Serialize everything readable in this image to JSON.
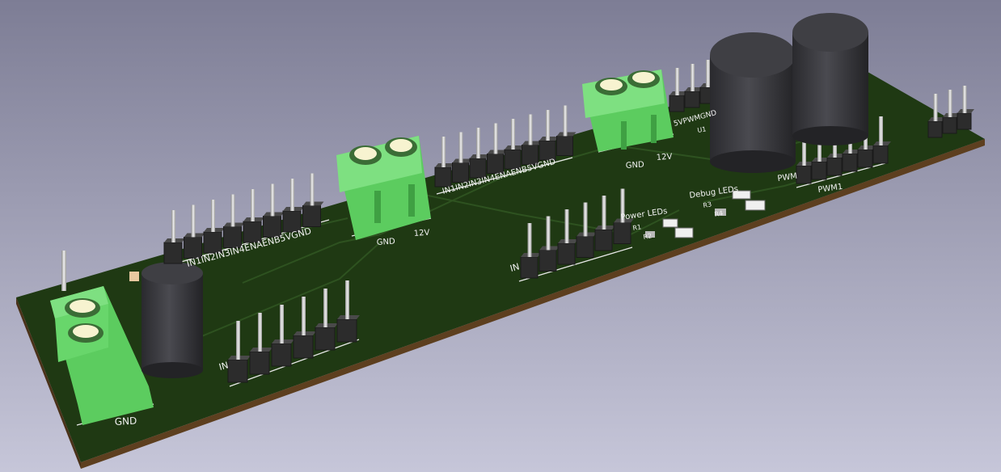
{
  "scene": {
    "background_top": "#7d7d95",
    "background_bottom": "#c6c6d9",
    "pcb_color": "#203a14",
    "pcb_edge_color": "#6b4a26",
    "terminal_green": "#62d465",
    "header_color": "#303030",
    "capacitor_color": "#3a3a3e"
  },
  "silkscreen": {
    "header1_pins": "IN1IN2IN3IN4ENAENB5VGND",
    "header2_pins": "IN1IN2IN3IN4ENAENB5VGND",
    "header3_pins": "5VPWMGND",
    "terminal1_gnd": "GND",
    "terminal1_12v": "12V",
    "terminal2_gnd": "GND",
    "terminal2_12v": "12V",
    "terminal_left_gnd": "GND",
    "power_leds": "Power LEDs",
    "debug_leds": "Debug LEDs",
    "pwm1": "PWM1",
    "pwm_left": "PWM",
    "r1": "R1",
    "r2": "R2",
    "r3": "R3",
    "r4": "R4",
    "in_left": "IN",
    "in_mid": "IN",
    "u1": "U1"
  }
}
